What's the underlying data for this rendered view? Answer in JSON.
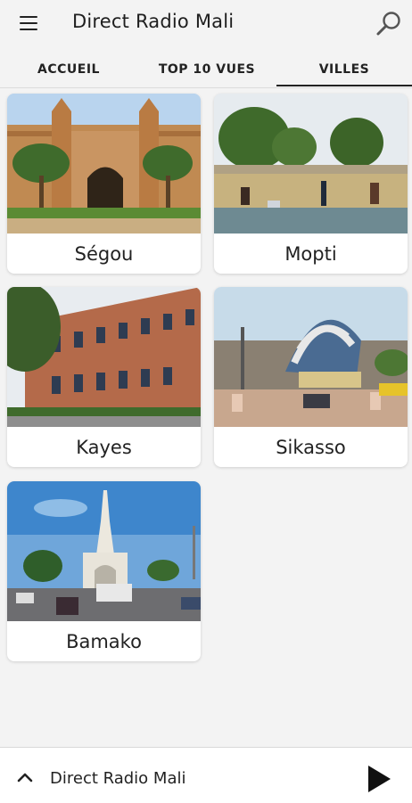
{
  "app": {
    "title": "Direct Radio Mali"
  },
  "tabs": [
    {
      "label": "ACCUEIL",
      "selected": false
    },
    {
      "label": "TOP 10 VUES",
      "selected": false
    },
    {
      "label": "VILLES",
      "selected": true
    }
  ],
  "cities": [
    {
      "name": "Ségou"
    },
    {
      "name": "Mopti"
    },
    {
      "name": "Kayes"
    },
    {
      "name": "Sikasso"
    },
    {
      "name": "Bamako"
    }
  ],
  "player": {
    "title": "Direct Radio Mali",
    "state_icon": "play-icon"
  }
}
